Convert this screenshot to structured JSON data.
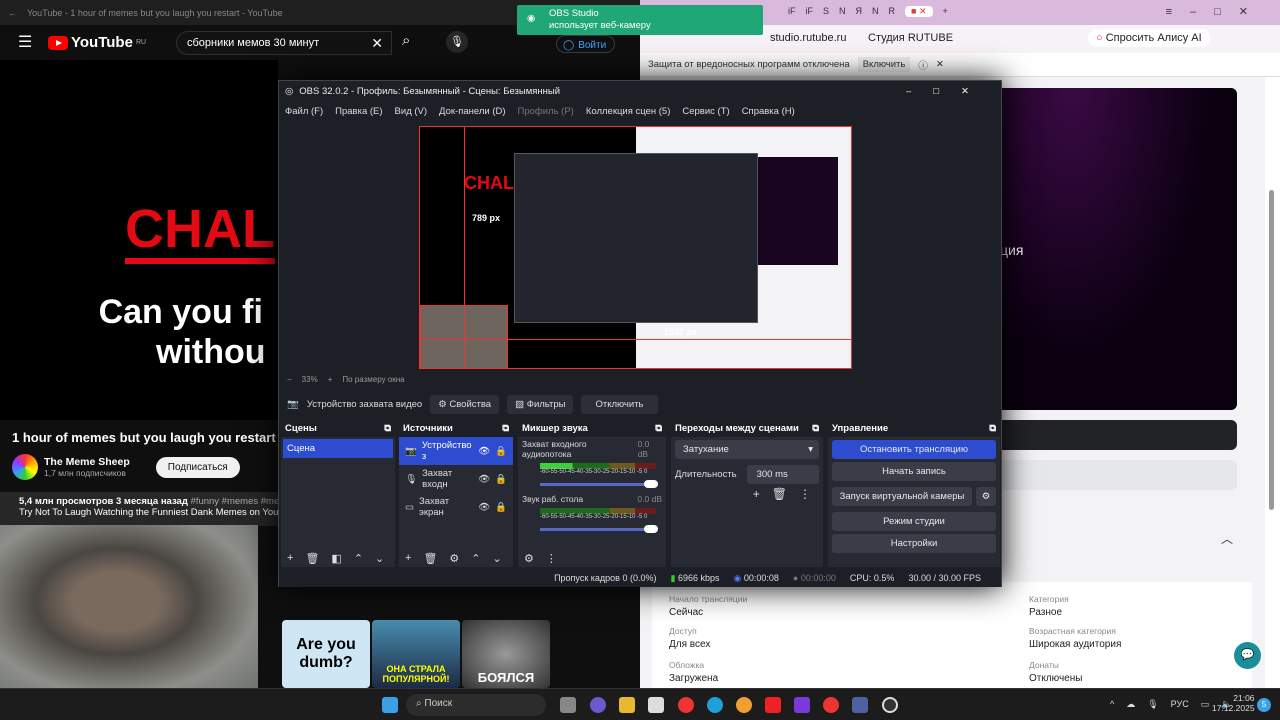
{
  "youtube": {
    "tab_title": "YouTube - 1 hour of memes but you laugh you restart - YouTube",
    "logo": "YouTube",
    "region": "RU",
    "search_value": "сборники мемов 30 минут",
    "signin": "Войти",
    "video_text_1": "CHAL",
    "video_text_2": "Can you fi",
    "video_text_3": "withou",
    "video_title": "1 hour of memes but you laugh you restart",
    "channel": "The Meme Sheep",
    "subscribers": "1,7 млн подписчиков",
    "subscribe": "Подписаться",
    "views": "5,4 млн просмотров",
    "age": "3 месяца назад",
    "tags": "#funny #memes #memes",
    "description": "Try Not To Laugh Watching the Funniest Dank Memes on YouTube",
    "thumbs": [
      "Are you dumb?",
      "ОНА СТРАЛА ПОПУЛЯРНОЙ!",
      "БОЯЛСЯ"
    ]
  },
  "notification": {
    "app": "OBS Studio",
    "text": "использует веб-камеру"
  },
  "browser": {
    "tabs": [
      "iF",
      "iF",
      "S",
      "N",
      "Я",
      "N",
      "R"
    ],
    "url": "studio.rutube.ru",
    "page_title": "Студия RUTUBE",
    "alice": "Спросить Алису AI",
    "warning": "Защита от вредоносных программ отключена",
    "enable": "Включить",
    "hero_text": "ция",
    "fields": [
      {
        "label": "Начало трансляции",
        "value": "Сейчас"
      },
      {
        "label": "Категория",
        "value": "Разное"
      },
      {
        "label": "Доступ",
        "value": "Для всех"
      },
      {
        "label": "Возрастная категория",
        "value": "Широкая аудитория"
      },
      {
        "label": "Обложка",
        "value": "Загружена"
      },
      {
        "label": "Донаты",
        "value": "Отключены"
      }
    ]
  },
  "obs": {
    "title": "OBS 32.0.2 - Профиль: Безымянный - Сцены: Безымянный",
    "menu": [
      "Файл (F)",
      "Правка (E)",
      "Вид (V)",
      "Док-панели (D)",
      "Профиль (P)",
      "Коллекция сцен (5)",
      "Сервис (T)",
      "Справка (H)"
    ],
    "preview_labels": {
      "height": "789 px",
      "width": "1532 px"
    },
    "zoom": "33%",
    "fit": "По размеру окна",
    "source_bar": {
      "source": "Устройство захвата видео",
      "properties": "Свойства",
      "filters": "Фильтры",
      "deactivate": "Отключить"
    },
    "scenes": {
      "title": "Сцены",
      "items": [
        "Сцена"
      ]
    },
    "sources": {
      "title": "Источники",
      "items": [
        "Устройство з",
        "Захват входн",
        "Захват экран"
      ]
    },
    "mixer": {
      "title": "Микшер звука",
      "channels": [
        {
          "name": "Захват входного аудиопотока",
          "db": "0.0 dB"
        },
        {
          "name": "Звук раб. стола",
          "db": "0.0 dB"
        }
      ],
      "scale": "-60-55-50-45-40-35-30-25-20-15-10 -5 0"
    },
    "transitions": {
      "title": "Переходы между сценами",
      "selected": "Затухание",
      "duration_label": "Длительность",
      "duration": "300 ms"
    },
    "controls": {
      "title": "Управление",
      "stop_stream": "Остановить трансляцию",
      "start_record": "Начать запись",
      "virtual_cam": "Запуск виртуальной камеры",
      "studio_mode": "Режим студии",
      "settings": "Настройки"
    },
    "status": {
      "dropped": "Пропуск кадров 0 (0.0%)",
      "bitrate": "6966 kbps",
      "stream_time": "00:00:08",
      "record_time": "00:00:00",
      "cpu": "CPU: 0.5%",
      "fps": "30.00 / 30.00 FPS"
    }
  },
  "taskbar": {
    "search": "Поиск",
    "lang": "РУС",
    "time": "21:06",
    "date": "17.12.2025",
    "badge": "5"
  }
}
